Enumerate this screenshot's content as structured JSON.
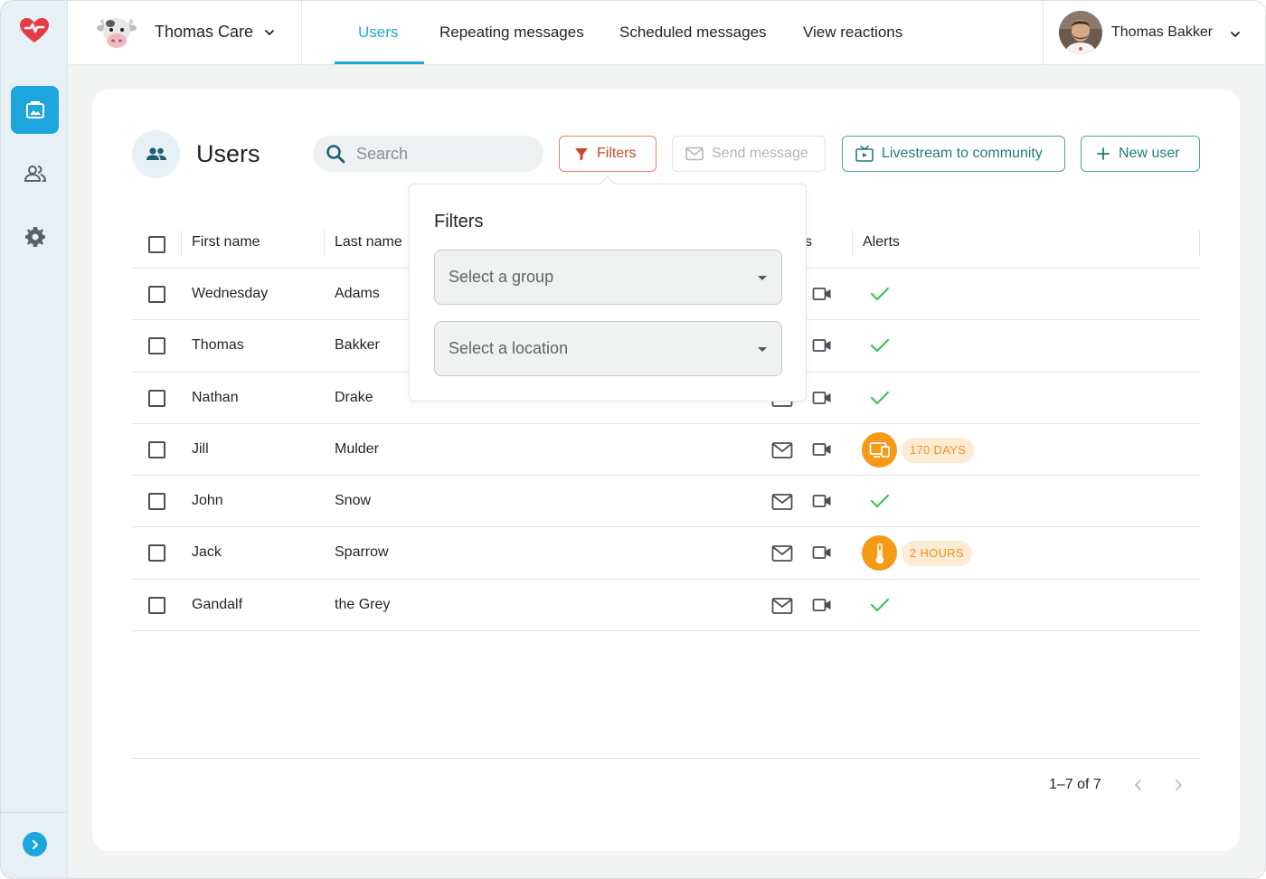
{
  "app": {
    "org_name": "Thomas Care",
    "user_name": "Thomas Bakker",
    "accent_color": "#1da6dd"
  },
  "nav": {
    "tabs": [
      {
        "label": "Users",
        "active": true
      },
      {
        "label": "Repeating messages",
        "active": false
      },
      {
        "label": "Scheduled messages",
        "active": false
      },
      {
        "label": "View reactions",
        "active": false
      }
    ]
  },
  "sidebar": {
    "items": [
      {
        "icon": "image-frame-icon",
        "active": true
      },
      {
        "icon": "users-icon",
        "active": false
      },
      {
        "icon": "gear-icon",
        "active": false
      }
    ],
    "expand_icon": "chevron-right-icon"
  },
  "page": {
    "title": "Users",
    "search_placeholder": "Search",
    "buttons": {
      "filters": "Filters",
      "send_message": "Send message",
      "livestream": "Livestream to community",
      "new_user": "New user"
    }
  },
  "table": {
    "headers": {
      "first_name": "First name",
      "last_name": "Last name",
      "contact_partial": "s",
      "alerts": "Alerts"
    },
    "rows": [
      {
        "first": "Wednesday",
        "last": "Adams",
        "alert": "ok"
      },
      {
        "first": "Thomas",
        "last": "Bakker",
        "alert": "ok"
      },
      {
        "first": "Nathan",
        "last": "Drake",
        "alert": "ok"
      },
      {
        "first": "Jill",
        "last": "Mulder",
        "alert": "device",
        "alert_text": "170 DAYS"
      },
      {
        "first": "John",
        "last": "Snow",
        "alert": "ok"
      },
      {
        "first": "Jack",
        "last": "Sparrow",
        "alert": "temperature",
        "alert_text": "2 HOURS"
      },
      {
        "first": "Gandalf",
        "last": "the Grey",
        "alert": "ok"
      }
    ]
  },
  "pagination": {
    "range": "1–7 of 7"
  },
  "filters_popover": {
    "title": "Filters",
    "group_placeholder": "Select a group",
    "location_placeholder": "Select a location"
  }
}
